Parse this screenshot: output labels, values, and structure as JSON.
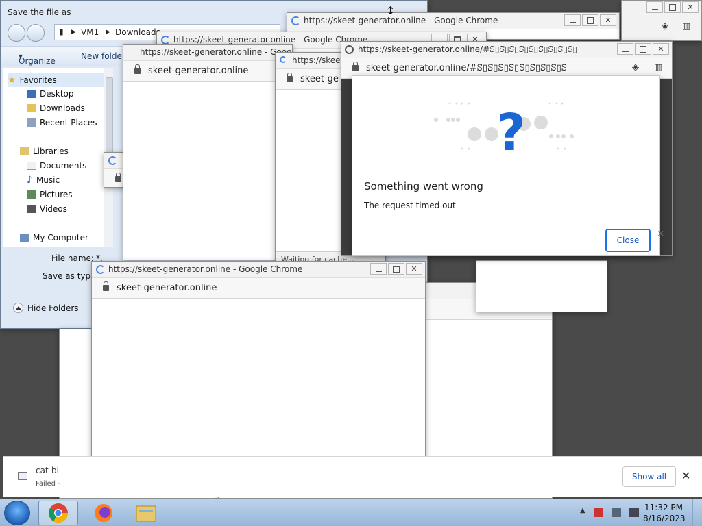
{
  "save_dialog": {
    "title": "Save the file as",
    "path": [
      "VM1",
      "Downloads"
    ],
    "toolbar": {
      "organize": "Organize",
      "new_folder": "New folder"
    },
    "nav": {
      "favorites": "Favorites",
      "desktop": "Desktop",
      "downloads": "Downloads",
      "recent_places": "Recent Places",
      "libraries": "Libraries",
      "documents": "Documents",
      "music": "Music",
      "pictures": "Pictures",
      "videos": "Videos",
      "my_computer": "My Computer"
    },
    "file_name_label": "File name:",
    "file_name_value": "*.",
    "save_as_type_label": "Save as type:",
    "hide_folders": "Hide Folders"
  },
  "windows": {
    "chrome_title": "https://skeet-generator.online - Google Chrome",
    "address": "skeet-generator.online",
    "address_short": "skeet-ge",
    "title_short": "https://skeet-",
    "main_title": "https://skeet-generator.online/#ꕶ▯ꕶ▯ꕶ▯ꕶ▯ꕶ▯ꕶ▯ꕶ▯ꕶ▯ꕶ▯",
    "main_address": "skeet-generator.online/#ꕶ▯ꕶ▯ꕶ▯ꕶ▯ꕶ▯ꕶ▯ꕶ▯ꕶ▯ꕶ",
    "waiting_status": "Waiting for cache..."
  },
  "error_dialog": {
    "title": "Something went wrong",
    "message": "The request timed out",
    "close_label": "Close"
  },
  "downloads_bar": {
    "file_name": "cat-bl",
    "status": "Failed -",
    "show_all": "Show all"
  },
  "taskbar": {
    "time": "11:32 PM",
    "date": "8/16/2023"
  },
  "colors": {
    "accent_blue": "#1a73e8",
    "desktop": "#4a4a4a",
    "taskbar": "#a9c4e3"
  }
}
